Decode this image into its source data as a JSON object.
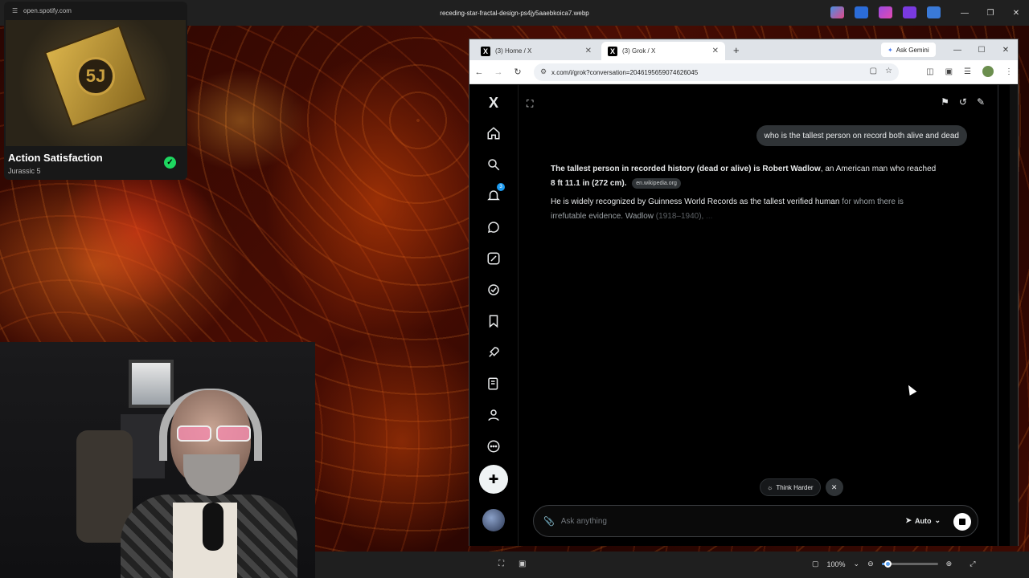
{
  "window": {
    "file_title": "receding-star-fractal-design-ps4jy5aaebkoica7.webp"
  },
  "spotify": {
    "url": "open.spotify.com",
    "track": "Action Satisfaction",
    "artist": "Jurassic 5",
    "album_mark": "5J"
  },
  "browser": {
    "tabs": [
      {
        "label": "(3) Home / X",
        "active": false
      },
      {
        "label": "(3) Grok / X",
        "active": true
      }
    ],
    "ask_gemini": "Ask Gemini",
    "address": "x.com/i/grok?conversation=2046195659074626045"
  },
  "xnav": {
    "notification_count": "3"
  },
  "grok": {
    "user_message": "who is the tallest person on record both alive and dead",
    "answer_bold": "The tallest person in recorded history (dead or alive) is Robert Wadlow",
    "answer_mid": ", an American man who reached ",
    "answer_height": "8 ft 11.1 in (272 cm).",
    "source_chip": "en.wikipedia.org",
    "answer_p2_a": "He is widely recognized by Guinness World Records as the tallest verified human",
    "answer_p2_b": " for whom there is",
    "answer_p2_c": "irrefutable evidence. Wadlow",
    "answer_p2_d": " (1918–1940),",
    "answer_p2_e": " ...",
    "think_harder": "Think Harder",
    "input_placeholder": "Ask anything",
    "mode": "Auto"
  },
  "viewer": {
    "zoom_level": "100%",
    "zoom_fraction": 0.1
  },
  "colors": {
    "x_blue": "#1d9bf0",
    "spotify_green": "#1ed760",
    "grok_bg": "#000000"
  }
}
